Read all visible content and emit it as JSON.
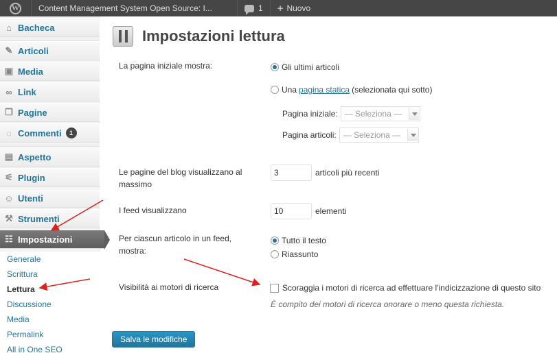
{
  "adminbar": {
    "site_name": "Content Management System Open Source: I...",
    "comment_count": "1",
    "new_label": "Nuovo"
  },
  "sidebar": {
    "items": [
      {
        "label": "Bacheca",
        "icon": "home-icon"
      },
      {
        "label": "Articoli",
        "icon": "pin-icon"
      },
      {
        "label": "Media",
        "icon": "media-icon"
      },
      {
        "label": "Link",
        "icon": "link-icon"
      },
      {
        "label": "Pagine",
        "icon": "pages-icon"
      },
      {
        "label": "Commenti",
        "icon": "comment-icon",
        "badge": "1"
      },
      {
        "label": "Aspetto",
        "icon": "appearance-icon"
      },
      {
        "label": "Plugin",
        "icon": "plugin-icon"
      },
      {
        "label": "Utenti",
        "icon": "users-icon"
      },
      {
        "label": "Strumenti",
        "icon": "tools-icon"
      },
      {
        "label": "Impostazioni",
        "icon": "settings-icon",
        "active": true
      }
    ],
    "submenu": [
      "Generale",
      "Scrittura",
      "Lettura",
      "Discussione",
      "Media",
      "Permalink",
      "All in One SEO"
    ]
  },
  "page": {
    "title": "Impostazioni lettura",
    "front_page": {
      "label": "La pagina iniziale mostra:",
      "option_latest": "Gli ultimi articoli",
      "option_static_prefix": "Una",
      "option_static_link": "pagina statica",
      "option_static_suffix": "(selezionata qui sotto)",
      "home_label": "Pagina iniziale:",
      "posts_label": "Pagina articoli:",
      "select_placeholder": "— Seleziona —"
    },
    "blog_pages": {
      "label_line1": "Le pagine del blog visualizzano al",
      "label_line2": "massimo",
      "value": "3",
      "suffix": "articoli più recenti"
    },
    "feed_count": {
      "label": "I feed visualizzano",
      "value": "10",
      "suffix": "elementi"
    },
    "feed_content": {
      "label_line1": "Per ciascun articolo in un feed,",
      "label_line2": "mostra:",
      "option_full": "Tutto il testo",
      "option_summary": "Riassunto"
    },
    "visibility": {
      "label": "Visibilità ai motori di ricerca",
      "checkbox_label": "Scoraggia i motori di ricerca ad effettuare l'indicizzazione di questo sito",
      "description": "È compito dei motori di ricerca onorare o meno questa richiesta."
    },
    "save_label": "Salva le modifiche"
  },
  "colors": {
    "adminbar_bg": "#464646",
    "link": "#21759b",
    "annotation_arrow": "#e0201c"
  }
}
